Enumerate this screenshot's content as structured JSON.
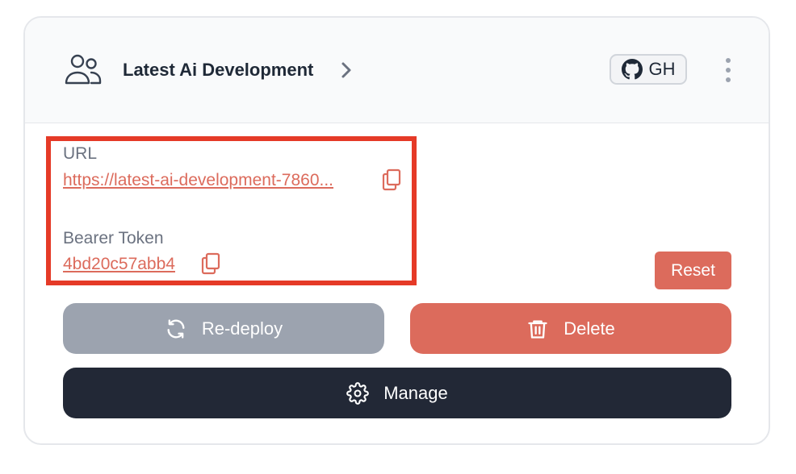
{
  "header": {
    "title": "Latest Ai Development",
    "badge_label": "GH"
  },
  "fields": {
    "url_label": "URL",
    "url_value": "https://latest-ai-development-7860...",
    "token_label": "Bearer Token",
    "token_value": "4bd20c57abb4"
  },
  "actions": {
    "reset_label": "Reset",
    "redeploy_label": "Re-deploy",
    "delete_label": "Delete",
    "manage_label": "Manage"
  },
  "colors": {
    "accent": "#dc6b5c",
    "highlight": "#e53a27",
    "dark": "#222836",
    "muted_button": "#9ca3af"
  },
  "icons": [
    "users-icon",
    "chevron-right-icon",
    "github-icon",
    "more-vertical-icon",
    "copy-icon",
    "refresh-icon",
    "trash-icon",
    "gear-icon"
  ]
}
